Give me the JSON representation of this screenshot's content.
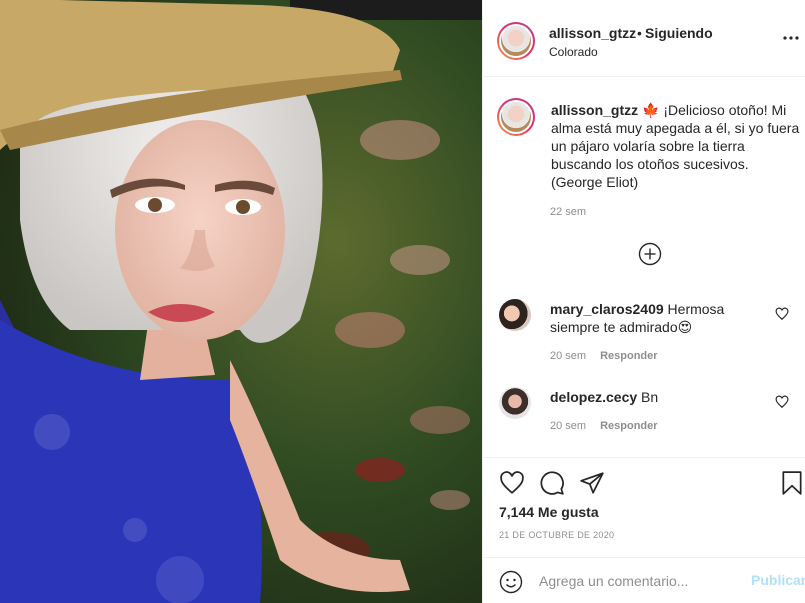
{
  "post": {
    "author": {
      "username": "allisson_gtzz",
      "separator": "•",
      "follow_status": "Siguiendo",
      "location": "Colorado"
    },
    "caption": {
      "username": "allisson_gtzz",
      "emoji": "🍁",
      "text": "¡Delicioso otoño! Mi alma está muy apegada a él, si yo fuera un pájaro volaría sobre la tierra buscando los otoños sucesivos. (George Eliot)",
      "time": "22 sem"
    },
    "comments": [
      {
        "username": "mary_claros2409",
        "text": "Hermosa siempre te admirado",
        "emoji": "😍",
        "time": "20 sem",
        "reply_label": "Responder"
      },
      {
        "username": "delopez.cecy",
        "text": "Bn",
        "emoji": "",
        "time": "20 sem",
        "reply_label": "Responder"
      }
    ],
    "likes": "7,144 Me gusta",
    "date": "21 DE OCTUBRE DE 2020",
    "add_comment": {
      "placeholder": "Agrega un comentario...",
      "post_label": "Publicar"
    }
  },
  "icons": {
    "more": "more-options-icon",
    "load_more": "load-more-comments-icon",
    "like": "heart-icon",
    "comment": "comment-icon",
    "share": "share-icon",
    "save": "bookmark-icon",
    "emoji": "emoji-icon"
  },
  "colors": {
    "primary_text": "#262626",
    "secondary_text": "#8e8e8e",
    "disabled_link": "#b2dffc",
    "border": "#efefef"
  }
}
